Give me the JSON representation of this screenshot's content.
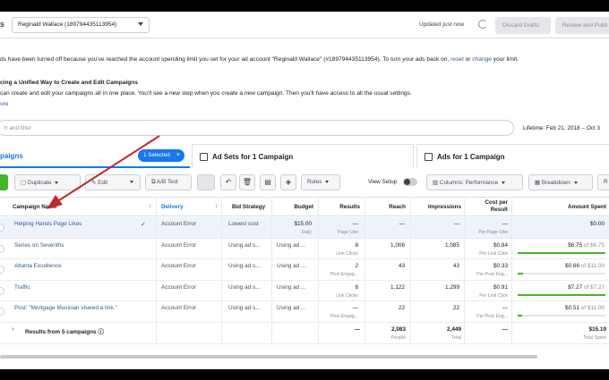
{
  "topbar": {
    "app_title_fragment": "s",
    "account": "Reginald Wallace (189794435113954)",
    "updated": "Updated just now",
    "discard_label": "Discard Drafts",
    "review_label": "Review and Publi"
  },
  "banner": {
    "line1_a": "ds have been turned off because you've reached the account spending limit you set for your ad account \"Reginald Wallace\" (#189794435113954). To turn your ads back on, ",
    "line1_reset": "reset",
    "line1_or": " or ",
    "line1_change": "change",
    "line1_b": " your limit.",
    "title": "cing a Unified Way to Create and Edit Campaigns",
    "body": "can create and edit your campaigns all in one place. You'll see a new step when you create a new campaign. Then you'll have access to all the usual settings.",
    "more": "ore"
  },
  "filter": {
    "placeholder": "h and filter",
    "lifetime": "Lifetime: Feb 21, 2018 – Oct 3"
  },
  "tabs": {
    "campaigns": "paigns",
    "selected": "1 Selected",
    "adsets": "Ad Sets for 1 Campaign",
    "ads": "Ads for 1 Campaign"
  },
  "toolbar": {
    "duplicate": "Duplicate",
    "edit": "Edit",
    "ab_test": "A/B Test",
    "rules": "Rules",
    "view_setup": "View Setup",
    "columns": "Columns: Performance",
    "breakdown": "Breakdown",
    "reports": "R"
  },
  "table": {
    "headers": {
      "name": "Campaign Name",
      "delivery": "Delivery",
      "bid_strategy": "Bid Strategy",
      "budget": "Budget",
      "results": "Results",
      "reach": "Reach",
      "impressions": "Impressions",
      "cost_per_result_1": "Cost per",
      "cost_per_result_2": "Result",
      "amount_spent": "Amount Spent"
    },
    "rows": [
      {
        "name": "Helping Hands Page Likes",
        "delivery": "Account Error",
        "bid": "Lowest cost",
        "budget": "$15.00",
        "budget_sub": "Daily",
        "results": "—",
        "results_sub": "Page Like",
        "reach": "—",
        "impressions": "—",
        "cost": "—",
        "cost_sub": "Per Page Like",
        "spent": "$0.00",
        "spent_sub": "",
        "spent_fraction": 0
      },
      {
        "name": "Series on Sevenths",
        "delivery": "Account Error",
        "bid": "Using ad s...",
        "budget": "Using ad ...",
        "budget_sub": "",
        "results": "8",
        "results_sub": "Link Clicks",
        "reach": "1,006",
        "impressions": "1,085",
        "cost": "$0.84",
        "cost_sub": "Per Link Click",
        "spent": "$6.75",
        "spent_sub": " of $6.75",
        "spent_fraction": 1
      },
      {
        "name": "Atlanta Excellence",
        "delivery": "Account Error",
        "bid": "Using ad s...",
        "budget": "Using ad ...",
        "budget_sub": "",
        "results": "2",
        "results_sub": "Post Engag...",
        "reach": "43",
        "impressions": "43",
        "cost": "$0.33",
        "cost_sub": "Per Post Eng...",
        "spent": "$0.66",
        "spent_sub": " of $11.00",
        "spent_fraction": 0.06
      },
      {
        "name": "Traffic",
        "delivery": "Account Error",
        "bid": "Using ad s...",
        "budget": "Using ad ...",
        "budget_sub": "",
        "results": "8",
        "results_sub": "Link Clicks",
        "reach": "1,122",
        "impressions": "1,299",
        "cost": "$0.91",
        "cost_sub": "Per Link Click",
        "spent": "$7.27",
        "spent_sub": " of $7.27",
        "spent_fraction": 1
      },
      {
        "name": "Post: \"Mortgage Musician shared a link.\"",
        "delivery": "Account Error",
        "bid": "Using ad s...",
        "budget": "Using ad ...",
        "budget_sub": "",
        "results": "—",
        "results_sub": "Post Engag...",
        "reach": "22",
        "impressions": "22",
        "cost": "—",
        "cost_sub": "Per Post Eng...",
        "spent": "$0.51",
        "spent_sub": " of $11.00",
        "spent_fraction": 0.05
      }
    ],
    "totals": {
      "label": "Results from 5 campaigns",
      "results": "—",
      "reach": "2,083",
      "reach_sub": "People",
      "impressions": "2,449",
      "impressions_sub": "Total",
      "cost": "—",
      "spent": "$15.19",
      "spent_sub": "Total Spent"
    }
  },
  "colors": {
    "accent": "#1877f2",
    "link": "#385898",
    "create": "#42b72a",
    "arrow": "#c0282d"
  }
}
